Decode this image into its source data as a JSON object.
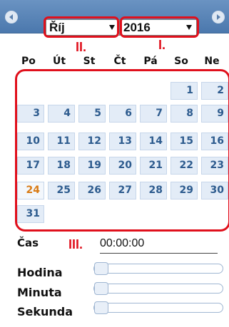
{
  "header": {
    "prev_icon": "chevron-left-icon",
    "next_icon": "chevron-right-icon",
    "month_select": "Říj",
    "year_select": "2016"
  },
  "annotations": {
    "month": "II.",
    "year": "I.",
    "time": "III."
  },
  "weekdays": [
    "Po",
    "Út",
    "St",
    "Čt",
    "Pá",
    "So",
    "Ne"
  ],
  "days": {
    "week1": [
      "",
      "",
      "",
      "",
      "",
      "1",
      "2"
    ],
    "week2": [
      "3",
      "4",
      "5",
      "6",
      "7",
      "8",
      "9"
    ],
    "week3": [
      "10",
      "11",
      "12",
      "13",
      "14",
      "15",
      "16"
    ],
    "week4": [
      "17",
      "18",
      "19",
      "20",
      "21",
      "22",
      "23"
    ],
    "week5": [
      "24",
      "25",
      "26",
      "27",
      "28",
      "29",
      "30"
    ],
    "week6": [
      "31"
    ]
  },
  "today": "24",
  "time": {
    "label": "Čas",
    "value": "00:00:00",
    "hour_label": "Hodina",
    "minute_label": "Minuta",
    "second_label": "Sekunda",
    "hour": 0,
    "minute": 0,
    "second": 0
  },
  "colors": {
    "annotation": "#e0101c",
    "header": "#5a84b6",
    "today": "#d97b15",
    "day_text": "#2d5b8e"
  }
}
